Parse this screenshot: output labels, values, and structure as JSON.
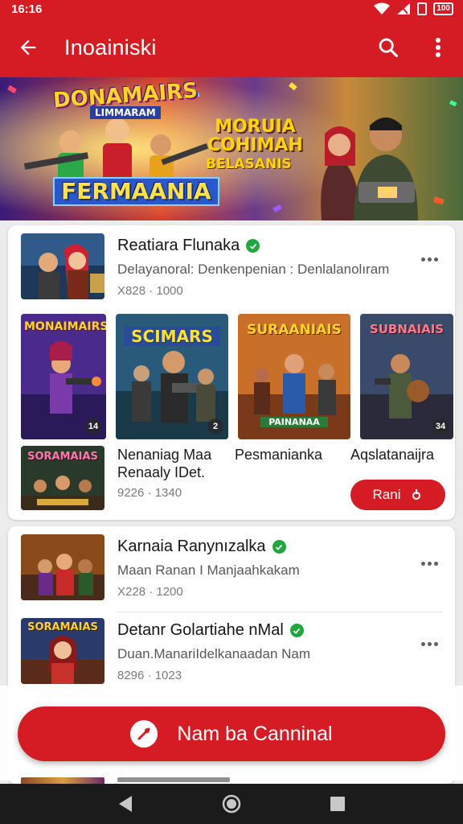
{
  "status": {
    "time": "16:16",
    "battery": "100"
  },
  "appbar": {
    "title": "Inoainiski",
    "back_icon": "arrow-left-icon",
    "search_icon": "search-icon",
    "more_icon": "more-vert-icon"
  },
  "banner": {
    "logo_left_title": "DONAMAIRS",
    "logo_left_sub": "LIMMARAM",
    "logo_bottom": "FERMAANIA",
    "center_line1": "MORUIA",
    "center_line2": "COHIMAH",
    "center_line3": "BELASANIS"
  },
  "card1": {
    "title": "Reatiara Flunaka",
    "subtitle": "Delayanoral: Denkenpenian : Denlalanolıram",
    "meta": "X828 · 1000",
    "tiles": [
      {
        "title": "MONAIMAIRS",
        "badge": "14"
      },
      {
        "title": "SCIMARS",
        "badge": "2"
      },
      {
        "title": "SURAANIAIS",
        "label": "PAINANAA",
        "badge": ""
      },
      {
        "title": "SUBNAIAIS",
        "badge": "34"
      }
    ],
    "bottom": {
      "thumb_title": "SORAMAIAS",
      "name1": "Nenaniag Maa Renaaly IDet.",
      "name2": "Pesmanianka",
      "name3": "Aqslatanaijra",
      "meta": "9226 · 1340",
      "install_label": "Rani"
    }
  },
  "card2": {
    "rows": [
      {
        "title": "Karnaia Ranynızalka",
        "subtitle": "Maan Ranan I Manjaahkakam",
        "meta": "X228 · 1200"
      },
      {
        "title": "Detanr Golartiahe nMal",
        "subtitle": "Duan.ManariIdelkanaadan Nam",
        "meta": "8296 · 1023"
      }
    ],
    "row_thumb_title": "SORAMAIAS"
  },
  "fab": {
    "label": "Nam ba Canninal",
    "icon": "gamepad-icon"
  },
  "navbar": {
    "back": "nav-back-icon",
    "home": "nav-home-icon",
    "recents": "nav-recents-icon"
  },
  "colors": {
    "primary": "#d51c24",
    "verified": "#22a63e",
    "navbar": "#1b1b1b"
  }
}
